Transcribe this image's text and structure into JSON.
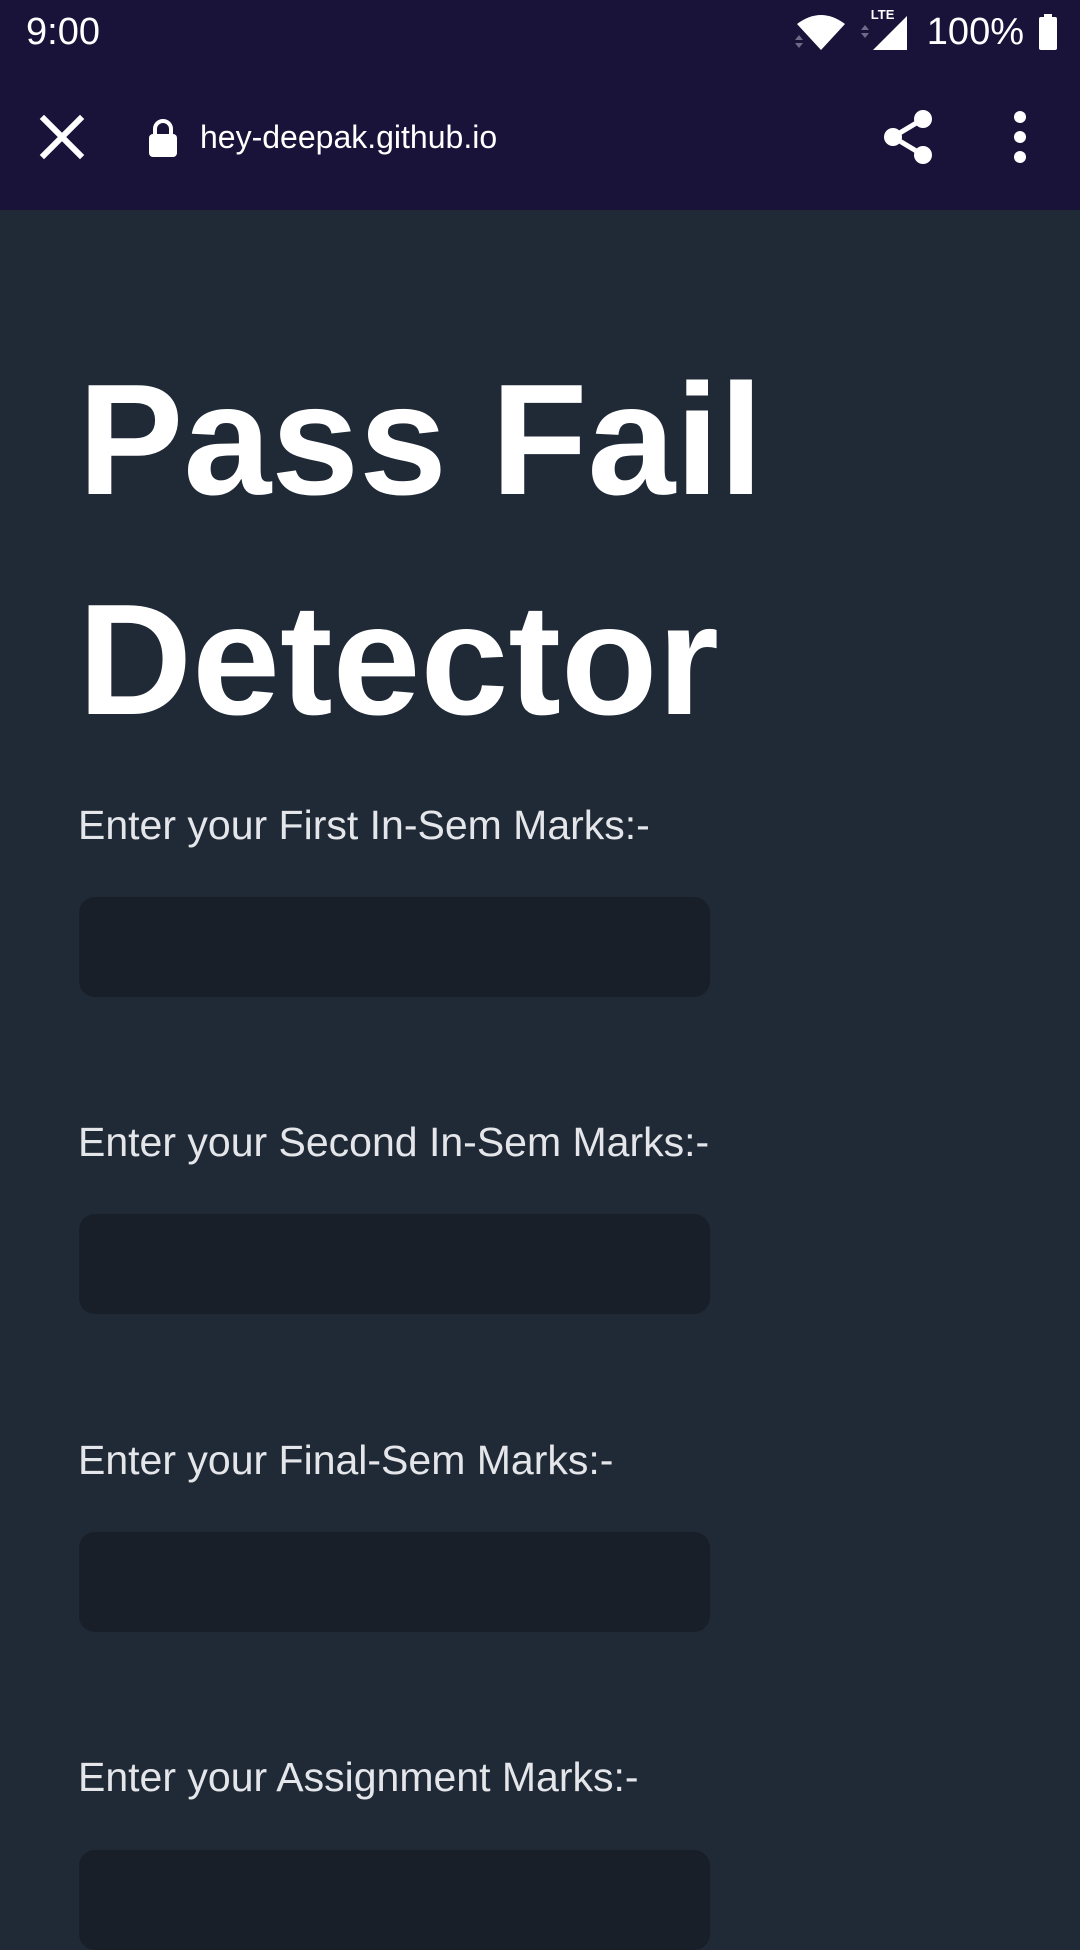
{
  "status_bar": {
    "time": "9:00",
    "network": "LTE",
    "battery": "100%",
    "icons": [
      "wifi-icon",
      "lte-signal-icon",
      "battery-icon"
    ]
  },
  "browser": {
    "url": "hey-deepak.github.io",
    "icons": [
      "close-icon",
      "lock-icon",
      "share-icon",
      "more-vert-icon"
    ]
  },
  "page": {
    "title_line1": "Pass Fail",
    "title_line2": "Detector",
    "fields": [
      {
        "label": "Enter your First In-Sem Marks:-",
        "value": "",
        "placeholder": ""
      },
      {
        "label": "Enter your Second In-Sem Marks:-",
        "value": "",
        "placeholder": ""
      },
      {
        "label": "Enter your Final-Sem Marks:-",
        "value": "",
        "placeholder": ""
      },
      {
        "label": "Enter your Assignment Marks:-",
        "value": "",
        "placeholder": ""
      }
    ]
  },
  "colors": {
    "chrome_bg": "#191339",
    "page_bg": "#202a37",
    "input_bg": "#181f29",
    "title_text": "#ffffff",
    "label_text": "#e4e6ea"
  }
}
